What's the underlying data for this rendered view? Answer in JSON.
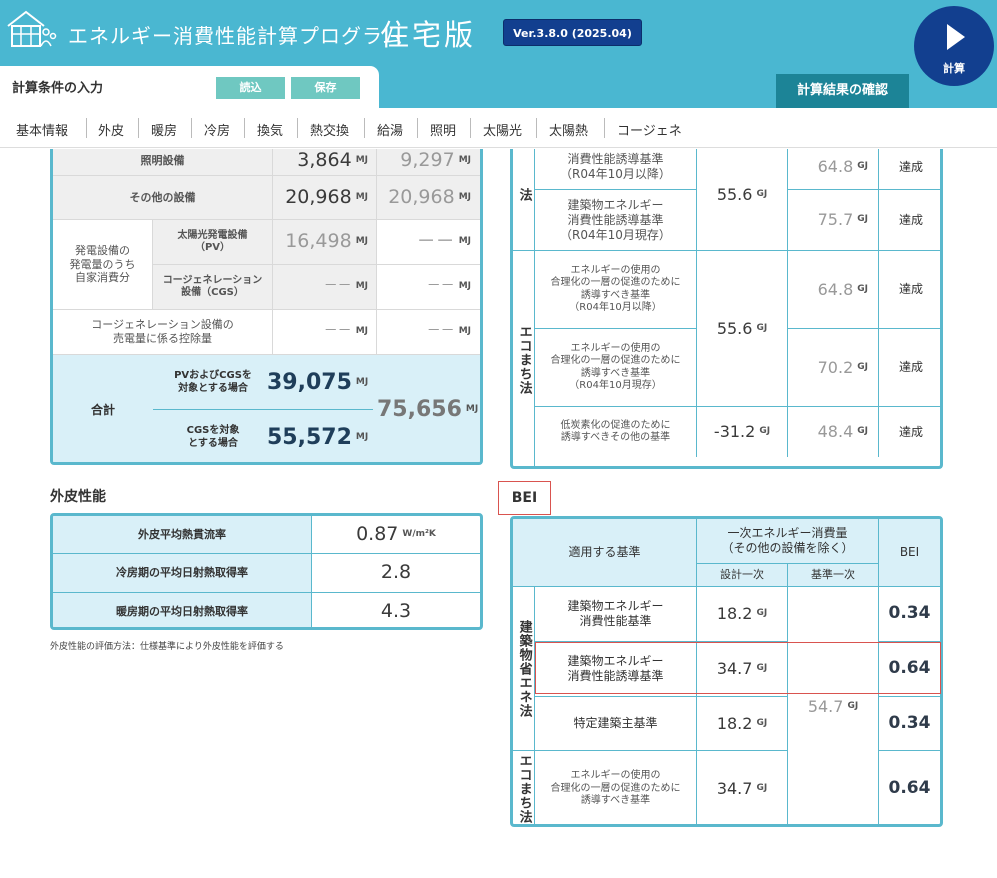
{
  "header": {
    "title": "エネルギー消費性能計算プログラム",
    "title_big": "住宅版",
    "version": "Ver.3.8.0 (2025.04)",
    "calc_label": "計算",
    "result_tab": "計算結果の確認"
  },
  "cond": {
    "title": "計算条件の入力",
    "load": "読込",
    "save": "保存"
  },
  "nav": [
    "基本情報",
    "外皮",
    "暖房",
    "冷房",
    "換気",
    "熱交換",
    "給湯",
    "照明",
    "太陽光",
    "太陽熱",
    "コージェネ"
  ],
  "left": {
    "lighting": {
      "label": "照明設備",
      "v1": "3,864",
      "v2": "9,297"
    },
    "other": {
      "label": "その他の設備",
      "v1": "20,968",
      "v2": "20,968"
    },
    "gen_group": "発電設備の\n発電量のうち\n自家消費分",
    "pv": {
      "label": "太陽光発電設備\n（PV）",
      "v1": "16,498",
      "v2": "－－"
    },
    "cgs": {
      "label": "コージェネレーション\n設備（CGS）",
      "v1": "－－",
      "v2": "－－"
    },
    "cgs_sell": {
      "label": "コージェネレーション設備の\n売電量に係る控除量",
      "v1": "－－",
      "v2": "－－"
    },
    "total": {
      "label": "合計",
      "pv_cgs_label": "PVおよびCGSを\n対象とする場合",
      "pv_cgs_val": "39,075",
      "cgs_label": "CGSを対象\nとする場合",
      "cgs_val": "55,572",
      "std_val": "75,656"
    },
    "unit": "MJ"
  },
  "right": {
    "top_group": "法",
    "r1": {
      "label": "消費性能誘導基準\n（R04年10月以降）",
      "std": "64.8",
      "result": "達成"
    },
    "r2": {
      "label": "建築物エネルギー\n消費性能誘導基準\n（R04年10月現存）",
      "std": "75.7",
      "result": "達成"
    },
    "design1": "55.6",
    "eco_group": "エコまち法",
    "r3": {
      "label": "エネルギーの使用の\n合理化の一層の促進のために\n誘導すべき基準\n（R04年10月以降）",
      "std": "64.8",
      "result": "達成"
    },
    "r4": {
      "label": "エネルギーの使用の\n合理化の一層の促進のために\n誘導すべき基準\n（R04年10月現存）",
      "std": "70.2",
      "result": "達成"
    },
    "design2": "55.6",
    "r5": {
      "label": "低炭素化の促進のために\n誘導すべきその他の基準",
      "design": "-31.2",
      "std": "48.4",
      "result": "達成"
    },
    "unit": "GJ"
  },
  "envelope": {
    "title": "外皮性能",
    "rows": [
      {
        "label": "外皮平均熱貫流率",
        "value": "0.87",
        "unit": "W/m²K"
      },
      {
        "label": "冷房期の平均日射熱取得率",
        "value": "2.8",
        "unit": ""
      },
      {
        "label": "暖房期の平均日射熱取得率",
        "value": "4.3",
        "unit": ""
      }
    ],
    "note": "外皮性能の評価方法：仕様基準により外皮性能を評価する"
  },
  "bei": {
    "title": "BEI",
    "h_basis": "適用する基準",
    "h_energy": "一次エネルギー消費量\n（その他の設備を除く）",
    "h_design": "設計一次",
    "h_std": "基準一次",
    "h_bei": "BEI",
    "group1": "建築物省エネ法",
    "group2": "エコまち法",
    "rows": [
      {
        "label": "建築物エネルギー\n消費性能基準",
        "design": "18.2",
        "bei": "0.34"
      },
      {
        "label": "建築物エネルギー\n消費性能誘導基準",
        "design": "34.7",
        "bei": "0.64"
      },
      {
        "label": "特定建築主基準",
        "design": "18.2",
        "bei": "0.34"
      },
      {
        "label": "エネルギーの使用の\n合理化の一層の促進のために\n誘導すべき基準",
        "design": "34.7",
        "bei": "0.64"
      }
    ],
    "std_shared": "54.7",
    "unit": "GJ"
  }
}
